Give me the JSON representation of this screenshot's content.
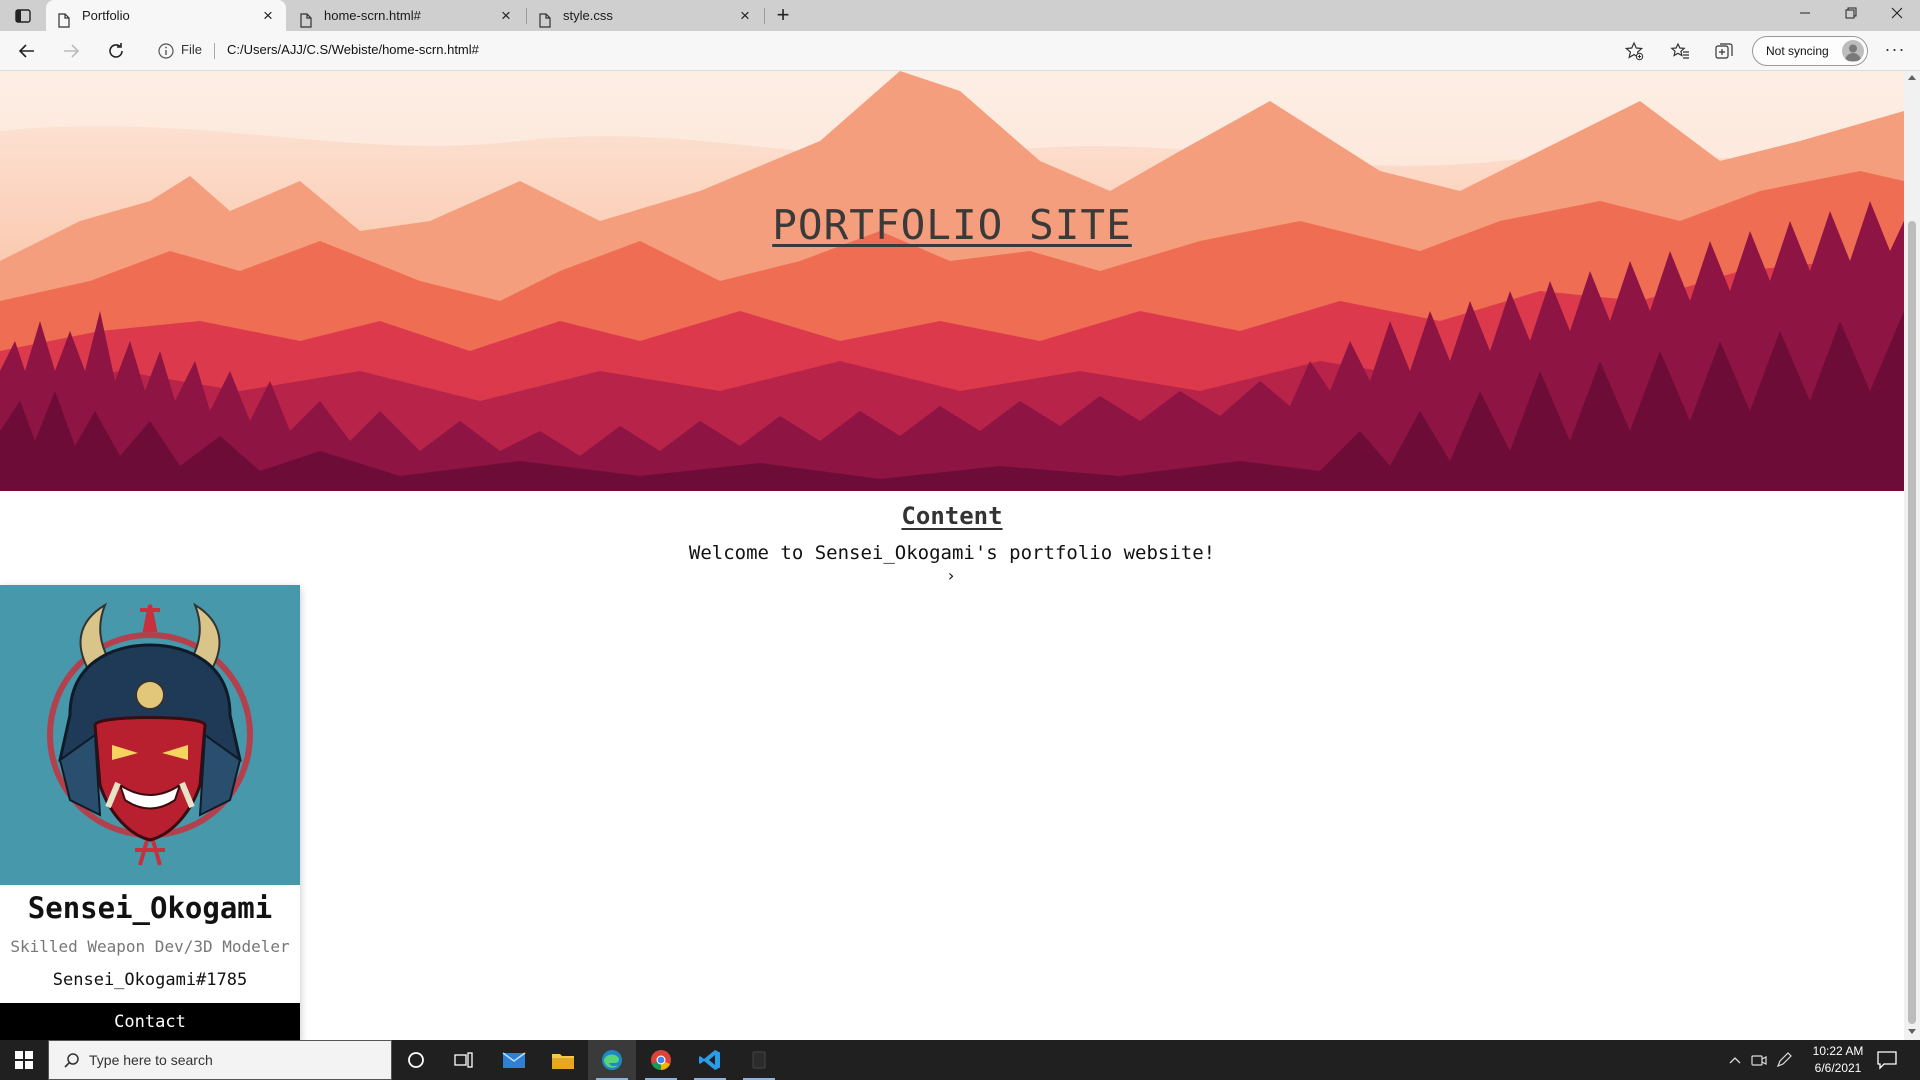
{
  "browser": {
    "tabs": [
      {
        "title": "Portfolio",
        "active": true
      },
      {
        "title": "home-scrn.html#",
        "active": false
      },
      {
        "title": "style.css",
        "active": false
      }
    ],
    "address": {
      "scheme_label": "File",
      "url": "C:/Users/AJJ/C.S/Webiste/home-scrn.html#"
    },
    "profile": {
      "sync_label": "Not syncing"
    }
  },
  "page": {
    "hero_title": "PORTFOLIO SITE",
    "content_heading": "Content",
    "welcome_text": "Welcome to Sensei_Okogami's portfolio website!",
    "chevron": "›",
    "card": {
      "name": "Sensei_Okogami",
      "role": "Skilled Weapon Dev/3D Modeler",
      "tag": "Sensei_Okogami#1785",
      "contact_label": "Contact",
      "image_background": "#4698aa"
    }
  },
  "taskbar": {
    "search_placeholder": "Type here to search",
    "time": "10:22 AM",
    "date": "6/6/2021",
    "apps": [
      "cortana-icon",
      "task-view-icon",
      "mail-icon",
      "file-explorer-icon",
      "edge-icon",
      "chrome-icon",
      "vscode-icon",
      "app-icon"
    ]
  },
  "colors": {
    "hero_sky": "#fbe7dc",
    "hero_mountains": "#ef6a4e",
    "hero_forest": "#7a0f3c",
    "card_contact_bg": "#000000"
  }
}
